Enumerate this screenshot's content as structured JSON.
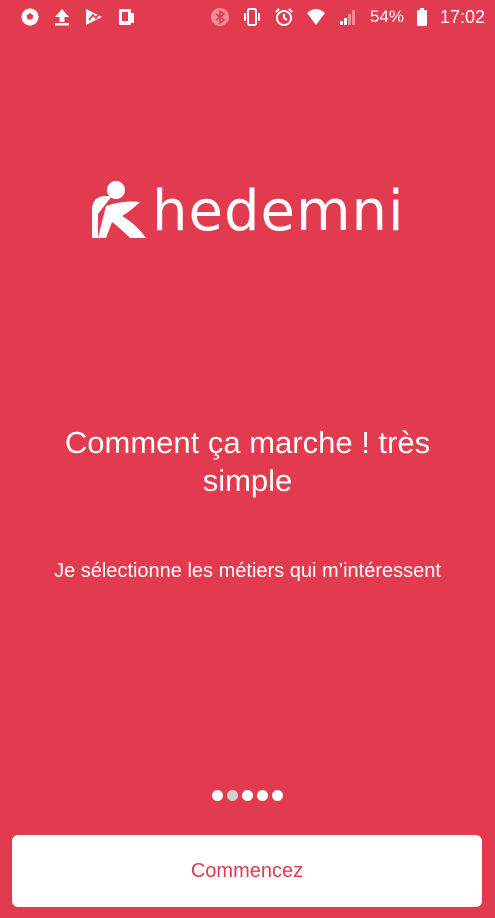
{
  "status_bar": {
    "left_icons": [
      "soccer-ball-icon",
      "upload-icon",
      "play-store-icon",
      "device-sync-icon"
    ],
    "right_icons": [
      "bluetooth-icon",
      "vibrate-icon",
      "alarm-icon",
      "wifi-icon",
      "signal-icon"
    ],
    "battery": "54%",
    "time": "17:02"
  },
  "logo": {
    "text": "hedemni"
  },
  "onboarding": {
    "headline": "Comment ça marche ! très simple",
    "description": "Je sélectionne les métiers qui m’intéressent",
    "page_count": 5,
    "active_page": 2
  },
  "cta": {
    "label": "Commencez"
  },
  "colors": {
    "background": "#e23a4e",
    "button": "#ffffff",
    "button_text": "#e23a4e"
  }
}
